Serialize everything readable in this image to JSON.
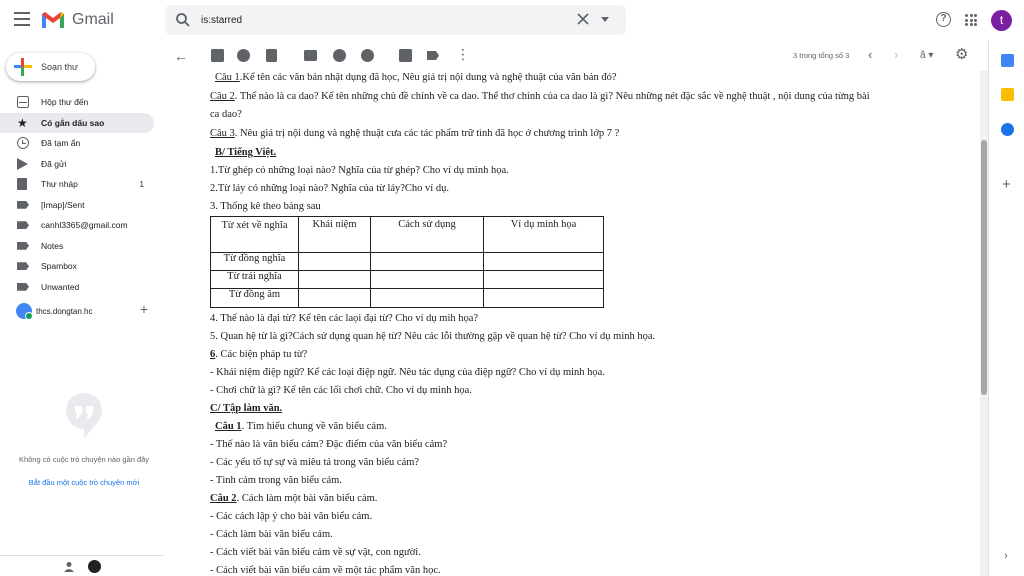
{
  "app": {
    "name": "Gmail",
    "avatar_letter": "t"
  },
  "search": {
    "value": "is:starred"
  },
  "sidebar": {
    "compose_label": "Soạn thư",
    "items": [
      {
        "label": "Hộp thư đến",
        "icon": "inbox-icon"
      },
      {
        "label": "Có gắn dấu sao",
        "icon": "star-icon",
        "active": true
      },
      {
        "label": "Đã tạm ẩn",
        "icon": "clock-icon"
      },
      {
        "label": "Đã gửi",
        "icon": "send-icon"
      },
      {
        "label": "Thư nháp",
        "icon": "draft-icon",
        "count": "1"
      },
      {
        "label": "[Imap]/Sent",
        "icon": "label-icon"
      },
      {
        "label": "canhl3365@gmail.com",
        "icon": "label-icon"
      },
      {
        "label": "Notes",
        "icon": "label-icon"
      },
      {
        "label": "Spambox",
        "icon": "label-icon"
      },
      {
        "label": "Unwanted",
        "icon": "label-icon"
      }
    ],
    "hangouts_user": "thcs.dongtan.hc",
    "hangouts_empty": "Không có cuộc trò chuyện nào gần đây",
    "hangouts_link": "Bắt đầu một cuộc trò chuyện mới"
  },
  "toolbar": {
    "pager": "3 trong tổng số 3"
  },
  "doc": {
    "lines": [
      {
        "pre": "",
        "u": "Câu 1",
        "text": ".Kể tên các văn bản   nhật dụng đã học, Nêu giá trị nội dung và nghệ thuật của văn bản đó?"
      },
      {
        "pre": "",
        "u": "Câu 2",
        "text": ".  Thế nào là ca dao? Kể tên những chủ đề chính về ca dao. Thể thơ chính của ca dao là gì? Nêu những nét đặc sắc về nghệ thuật , nội dung của từng bài"
      },
      {
        "pre": "",
        "u": "",
        "text": "ca dao?"
      },
      {
        "pre": "",
        "u": "Câu 3",
        "text": ".   Nêu giá trị nội dung và nghệ thuật cưa các tác phẩm trữ tình đã học ở chương trình lớp 7 ?"
      },
      {
        "pre": "",
        "u": "B/ Tiếng Việt.",
        "text": ""
      },
      {
        "pre": "",
        "u": "",
        "text": "1.Từ ghép   có những loại nào? Nghĩa của từ ghép? Cho ví dụ minh họa."
      },
      {
        "pre": "",
        "u": "",
        "text": "2.Từ láy có những loại nào? Nghĩa của từ láy?Cho ví dụ."
      },
      {
        "pre": "",
        "u": "",
        "text": "3. Thống kê theo bảng sau"
      },
      {
        "pre": "",
        "u": "",
        "text": "4. Thế nào là đại từ? Kể tên các laọi đại từ? Cho ví dụ mih họa?"
      },
      {
        "pre": "",
        "u": "",
        "text": "5. Quan hệ từ là gì?Cách sử dụng quan hệ từ? Nêu các lỗi thường gặp về quan hệ từ? Cho ví dụ minh họa."
      },
      {
        "pre": "",
        "u": "6",
        "text": ". Các biện pháp tu từ?"
      },
      {
        "pre": "",
        "u": "",
        "text": "  - Khái niệm điệp ngữ? Kể các loại điệp ngữ. Nêu tác dụng của điệp ngữ? Cho ví dụ minh họa."
      },
      {
        "pre": "",
        "u": "",
        "text": "  - Chơi chữ là gì? Kể tên các lối chơi chữ. Cho ví dụ minh họa."
      },
      {
        "pre": "",
        "u": "C/ Tập làm văn.",
        "text": ""
      },
      {
        "pre": "  ",
        "u": "Câu 1",
        "text": ". Tìm hiểu chung về văn biểu cảm."
      },
      {
        "pre": "",
        "u": "",
        "text": "- Thế nào là văn biểu cảm? Đặc điểm của văn biểu cảm?"
      },
      {
        "pre": "",
        "u": "",
        "text": "- Các yếu tố tự sự và miêu tả trong văn biểu cảm?"
      },
      {
        "pre": "",
        "u": "",
        "text": "- Tình cảm trong văn biểu cảm."
      },
      {
        "pre": "",
        "u": "Câu 2",
        "text": ". Cách làm một bài văn biểu cảm."
      },
      {
        "pre": "",
        "u": "",
        "text": "- Các cách lập ý cho bài văn biểu cảm."
      },
      {
        "pre": "",
        "u": "",
        "text": "- Cách làm bài văn biểu cảm."
      },
      {
        "pre": "",
        "u": "",
        "text": "- Cách viết bài văn biểu cảm về sự vật, con người."
      },
      {
        "pre": "",
        "u": "",
        "text": "- Cách viết bài văn biểu cảm về một tác phẩm văn học."
      }
    ],
    "table": {
      "headers": [
        "Từ   xét về nghĩa",
        "Khái niệm",
        "Cách sử dụng",
        "Ví dụ minh họa"
      ],
      "rows": [
        "Từ đồng nghĩa",
        "Từ trái nghĩa",
        "Từ đồng âm"
      ]
    }
  },
  "colors": {
    "gmail_red": "#ea4335",
    "active_bg": "#e8eaed",
    "avatar": "#7b1fa2",
    "link": "#1a73e8"
  }
}
